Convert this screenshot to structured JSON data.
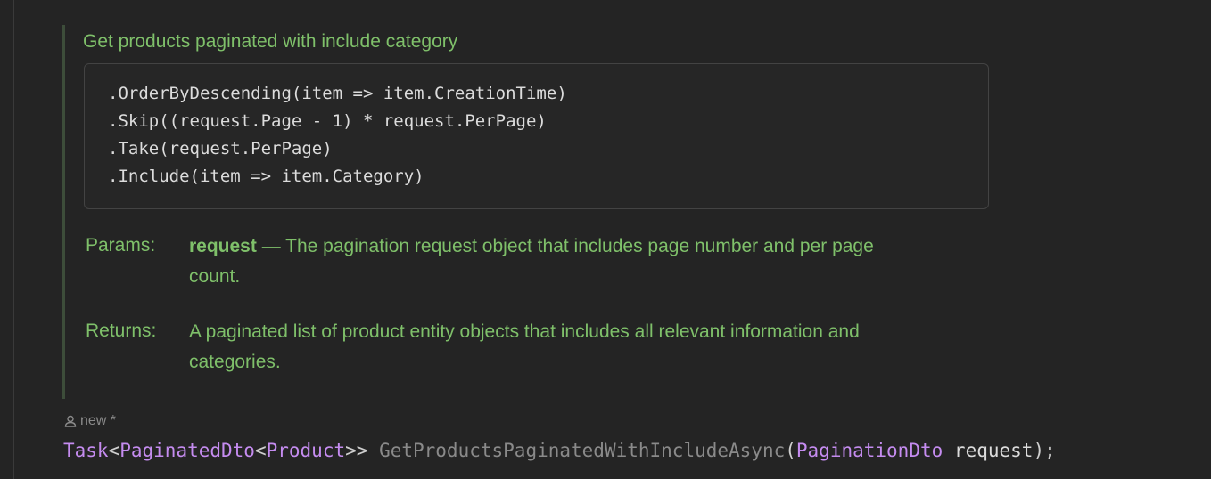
{
  "doc": {
    "title": "Get products paginated with include category",
    "code_lines": [
      ".OrderByDescending(item => item.CreationTime)",
      ".Skip((request.Page - 1) * request.PerPage)",
      ".Take(request.PerPage)",
      ".Include(item => item.Category)"
    ],
    "params_label": "Params:",
    "param_name": "request",
    "param_desc_line1": " — The pagination request object that includes page number and per page",
    "param_desc_line2": "count.",
    "returns_label": "Returns:",
    "returns_line1": "A paginated list of product entity objects that includes all relevant information and",
    "returns_line2": "categories."
  },
  "author": {
    "icon": "user-icon",
    "label": "new *"
  },
  "signature": {
    "return_type_outer": "Task",
    "lt1": "<",
    "return_type_mid": "PaginatedDto",
    "lt2": "<",
    "return_type_inner": "Product",
    "gt": ">>",
    "method_name": "GetProductsPaginatedWithIncludeAsync",
    "open_paren": "(",
    "param_type": "PaginationDto",
    "param_name": "request",
    "close": ");"
  },
  "colors": {
    "doc_text": "#7fc06a",
    "type": "#c58cf0",
    "method": "#8a8a8a",
    "background": "#242424"
  }
}
